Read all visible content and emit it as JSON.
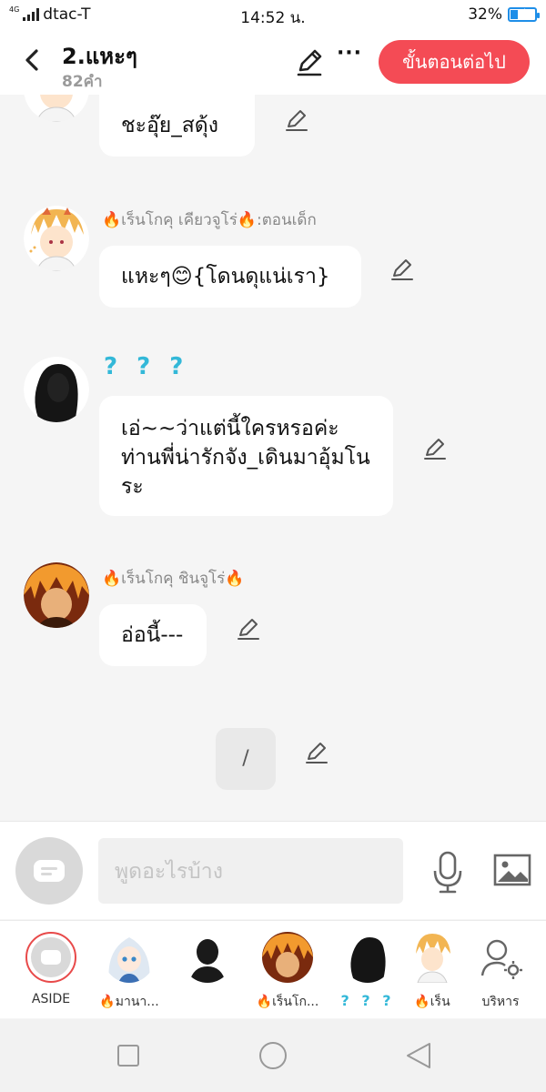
{
  "status_bar": {
    "network": "4G",
    "carrier": "dtac-T",
    "time": "14:52 น.",
    "battery_percent": "32%",
    "battery_level": 0.32
  },
  "header": {
    "title": "2.แหะๆ",
    "word_count": "82คำ",
    "next_button": "ขั้นตอนต่อไป",
    "more_label": "···"
  },
  "messages": [
    {
      "text": "ชะอุ๊ย_สดุ้ง",
      "avatar_icon": "boy-white-hair-avatar-icon"
    },
    {
      "name": "🔥เร็นโกคุ เคียวจูโร่🔥:ตอนเด็ก",
      "text": "แหะๆ😊{โดนดุแน่เรา}",
      "avatar_icon": "boy-white-hair-avatar-icon"
    },
    {
      "name": "? ? ?",
      "text": "เอ่~~ว่าแต่นี้ใครหรอค่ะท่านพี่น่ารักจัง_เดินมาอุ้มโนระ",
      "avatar_icon": "silhouette-avatar-icon"
    },
    {
      "name": "🔥เร็นโกคุ ชินจูโร่🔥",
      "text": "อ่อนี้---",
      "avatar_icon": "man-orange-hair-avatar-icon"
    }
  ],
  "divider": {
    "text": "/"
  },
  "composer": {
    "placeholder": "พูดอะไรบ้าง"
  },
  "characters": [
    {
      "label": "ASIDE",
      "icon": "aside-chat-icon"
    },
    {
      "label": "🔥มานา...",
      "icon": "girl-white-hair-avatar-icon"
    },
    {
      "label": "",
      "icon": "man-silhouette-avatar-icon"
    },
    {
      "label": "🔥เร็นโก...",
      "icon": "man-orange-hair-avatar-icon"
    },
    {
      "label": "? ? ?",
      "icon": "silhouette-avatar-icon"
    },
    {
      "label": "🔥เร็น",
      "icon": "boy-white-hair-avatar-icon"
    },
    {
      "label": "บริหาร",
      "icon": "manage-user-settings-icon"
    }
  ],
  "colors": {
    "accent_red": "#f44b55",
    "question_blue": "#33b8d8",
    "battery_blue": "#1e8ee8"
  }
}
